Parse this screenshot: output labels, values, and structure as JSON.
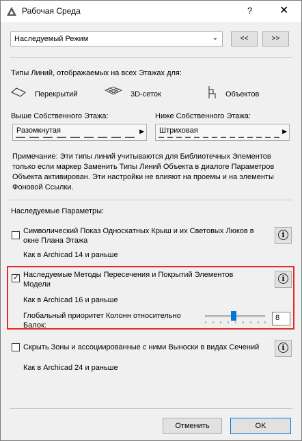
{
  "window": {
    "title": "Рабочая Среда",
    "help_label": "?",
    "close_label": "✕"
  },
  "mode": {
    "selected": "Наследуемый Режим",
    "prev_label": "<<",
    "next_label": ">>"
  },
  "line_types": {
    "heading": "Типы Линий, отображаемых на всех Этажах для:",
    "categories": [
      "Перекрытий",
      "3D-сеток",
      "Объектов"
    ],
    "above_label": "Выше Собственного Этажа:",
    "above_value": "Разомкнутая",
    "below_label": "Ниже Собственного Этажа:",
    "below_value": "Штриховая",
    "note": "Примечание: Эти типы линий учитываются для Библиотечных Элементов только если маркер Заменить Типы Линий Объекта в диалоге Параметров Объекта активирован. Эти настройки не влияют на проемы и на элементы Фоновой Ссылки."
  },
  "inherited": {
    "heading": "Наследуемые Параметры:",
    "options": [
      {
        "label": "Символический Показ Односкатных Крыш и их Световых Люков в окне Плана Этажа",
        "checked": false,
        "sub": "Как в Archicad 14 и раньше"
      },
      {
        "label": "Наследуемые Методы Пересечения и Покрытий Элементов Модели",
        "checked": true,
        "sub": "Как в Archicad 16 и раньше"
      },
      {
        "label": "Скрыть Зоны и ассоциированные с ними Выноски в видах Сечений",
        "checked": false,
        "sub": "Как в Archicad 24 и раньше"
      }
    ],
    "column_priority_label": "Глобальный приоритет Колонн относительно Балок:",
    "column_priority_value": "8",
    "column_priority_fraction": 0.5
  },
  "buttons": {
    "cancel": "Отменить",
    "ok": "OK"
  },
  "colors": {
    "highlight": "#e32a2a",
    "accent": "#0078d7"
  }
}
